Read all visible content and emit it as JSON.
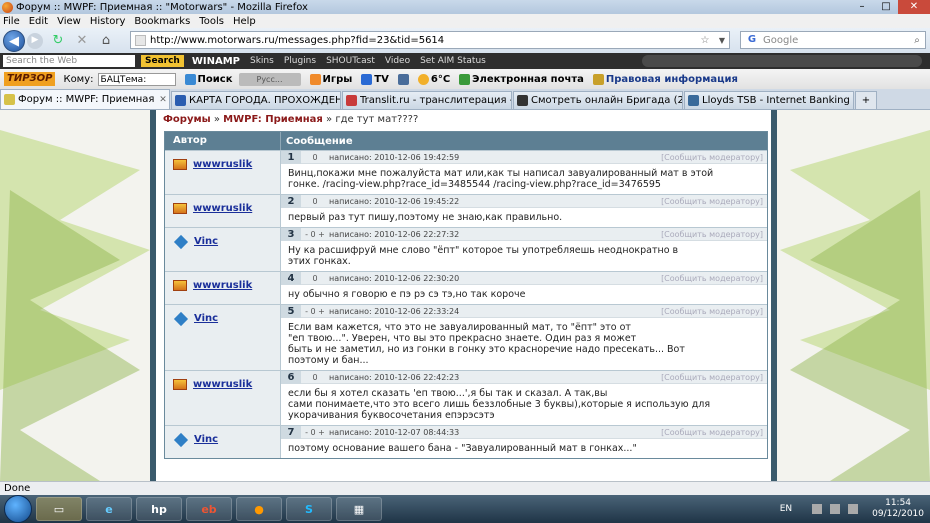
{
  "window": {
    "title": "Форум :: MWPF: Приемная :: \"Motorwars\" - Mozilla Firefox"
  },
  "menu": [
    "File",
    "Edit",
    "View",
    "History",
    "Bookmarks",
    "Tools",
    "Help"
  ],
  "nav": {
    "url": "http://www.motorwars.ru/messages.php?fid=23&tid=5614",
    "search_placeholder": "Google"
  },
  "winamp": {
    "search_placeholder": "Search the Web",
    "search_btn": "Search",
    "logo": "WINAMP",
    "items": [
      "Skins",
      "Plugins",
      "SHOUTcast",
      "Video",
      "Set AIM Status"
    ]
  },
  "tirzor": {
    "logo": "ТИРЗОР",
    "komu": "Кому:",
    "select": "БАЦТема:",
    "search": "Поиск",
    "gray": "Русс...",
    "games": "Игры",
    "tv": "TV",
    "weather": "6°C",
    "mail": "Электронная почта",
    "legal": "Правовая информация"
  },
  "tabs": [
    {
      "label": "Форум :: MWPF: Приемная :: \"M...",
      "active": true,
      "color": "#d6c24a"
    },
    {
      "label": "КАРТА ГОРОДА. ПРОХОЖДЕНИЕ ...",
      "active": false,
      "color": "#2a5db0"
    },
    {
      "label": "Translit.ru - транслитерация - пер...",
      "active": false,
      "color": "#c83a3a"
    },
    {
      "label": "Смотреть онлайн Бригада (2001) ...",
      "active": false,
      "color": "#333333"
    },
    {
      "label": "Lloyds TSB - Internet Banking - Log...",
      "active": false,
      "color": "#3a6a9a"
    }
  ],
  "breadcrumb": {
    "forums": "Форумы",
    "section": "MWPF: Приемная",
    "topic": "где тут мат????"
  },
  "table": {
    "col_author": "Автор",
    "col_message": "Сообщение",
    "date_prefix": "написано:",
    "report": "[Сообщить модератору]",
    "rows": [
      {
        "num": "1",
        "rate": "0",
        "author": "wwwruslik",
        "av": "w",
        "date": "2010-12-06 19:42:59",
        "body": "Винц,покажи мне пожалуйста мат или,как ты написал завуалированный мат в этой\nгонке. /racing-view.php?race_id=3485544 /racing-view.php?race_id=3476595"
      },
      {
        "num": "2",
        "rate": "0",
        "author": "wwwruslik",
        "av": "w",
        "date": "2010-12-06 19:45:22",
        "body": "первый раз тут пишу,поэтому не знаю,как правильно."
      },
      {
        "num": "3",
        "rate": "- 0 +",
        "author": "Vinc",
        "av": "v",
        "date": "2010-12-06 22:27:32",
        "body": "Ну ка расшифруй мне слово \"ёпт\" которое ты употребляешь неоднократно в\nэтих гонках."
      },
      {
        "num": "4",
        "rate": "0",
        "author": "wwwruslik",
        "av": "w",
        "date": "2010-12-06 22:30:20",
        "body": "ну обычно я говорю е пэ рэ сэ тэ,но так короче"
      },
      {
        "num": "5",
        "rate": "- 0 +",
        "author": "Vinc",
        "av": "v",
        "date": "2010-12-06 22:33:24",
        "body": "Если вам кажется, что это не завуалированный мат, то \"ёпт\" это от\n\"еп твою...\". Уверен, что вы это прекрасно знаете. Один раз я может\nбыть и не заметил, но из гонки в гонку это красноречие надо пресекать... Вот\nпоэтому и бан..."
      },
      {
        "num": "6",
        "rate": "0",
        "author": "wwwruslik",
        "av": "w",
        "date": "2010-12-06 22:42:23",
        "body": "если бы я хотел сказать 'еп твою...',я бы так и сказал. А так,вы\nсами понимаете,что это всего лишь беззлобные 3 буквы),которые я использую для\nукорачивания буквосочетания епэрэсэтэ"
      },
      {
        "num": "7",
        "rate": "- 0 +",
        "author": "Vinc",
        "av": "v",
        "date": "2010-12-07 08:44:33",
        "body": "поэтому основание вашего бана - \"Завуалированный мат в гонках...\""
      }
    ]
  },
  "status": "Done",
  "tray": {
    "lang": "EN",
    "time": "11:54",
    "date": "09/12/2010"
  }
}
